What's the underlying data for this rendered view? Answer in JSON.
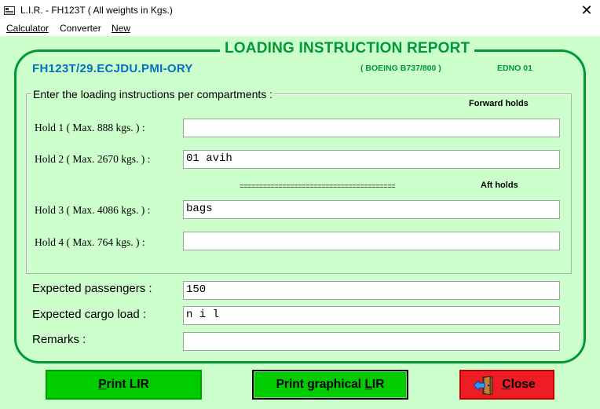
{
  "window": {
    "title": "L.I.R. - FH123T ( All weights in Kgs.)",
    "close_glyph": "✕"
  },
  "menu": [
    "Calculator",
    "Converter",
    "New"
  ],
  "report": {
    "title": "LOADING INSTRUCTION REPORT",
    "flight": "FH123T/29.ECJDU.PMI-ORY",
    "aircraft": "( BOEING B737/800 )",
    "edno": "EDNO 01"
  },
  "holds_group": {
    "caption": "Enter the loading instructions per compartments :",
    "forward_label": "Forward holds",
    "aft_label": "Aft holds",
    "separator": "========================================",
    "holds": [
      {
        "label": "Hold  1 ( Max.  888 kgs. ) :",
        "value": ""
      },
      {
        "label": "Hold  2 ( Max. 2670 kgs. ) :",
        "value": "01 avih"
      },
      {
        "label": "Hold  3 ( Max. 4086 kgs. ) :",
        "value": "bags"
      },
      {
        "label": "Hold  4 ( Max.  764 kgs. ) :",
        "value": ""
      }
    ]
  },
  "extra": {
    "passengers_label": "Expected passengers :",
    "passengers_value": "150",
    "cargo_label": "Expected cargo load :",
    "cargo_value": "n i l",
    "remarks_label": "Remarks :",
    "remarks_value": ""
  },
  "buttons": {
    "print_lir": {
      "accel": "P",
      "rest": "rint LIR"
    },
    "print_graphical": {
      "pre": "Print graphical ",
      "accel": "L",
      "rest": "IR"
    },
    "close": {
      "accel": "C",
      "rest": "lose"
    }
  },
  "icons": {
    "app": "window-app-icon",
    "close_button": "exit-door-icon"
  },
  "colors": {
    "background": "#ccffcc",
    "title_green": "#009933",
    "flight_blue": "#0070c0",
    "button_green": "#00cc00",
    "close_red": "#ee1c24"
  }
}
